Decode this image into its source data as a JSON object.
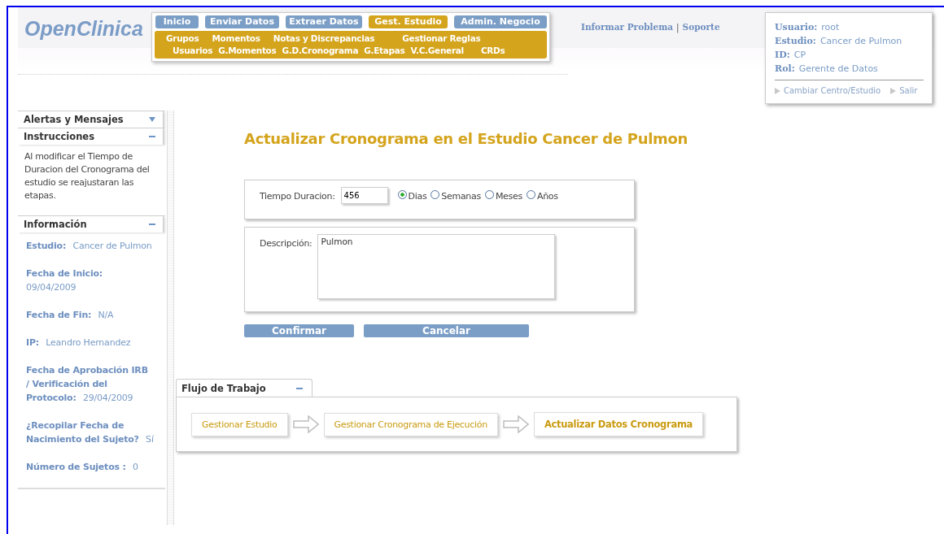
{
  "logo": "OpenClinica",
  "nav": {
    "main_tabs": [
      {
        "label": "Inicio",
        "selected": false
      },
      {
        "label": "Enviar Datos",
        "selected": false
      },
      {
        "label": "Extraer Datos",
        "selected": false
      },
      {
        "label": "Gest. Estudio",
        "selected": true
      },
      {
        "label": "Admin. Negocio",
        "selected": false
      }
    ],
    "sub_rows": [
      [
        "Grupos",
        "Momentos",
        "Notas y Discrepancias",
        "Gestionar Reglas"
      ],
      [
        "Usuarios",
        "G.Momentos",
        "G.D.Cronograma",
        "G.Etapas",
        "V.C.General",
        "CRDs"
      ]
    ]
  },
  "header_links": {
    "items": [
      "Informar Problema",
      "Soporte"
    ],
    "separator": "|"
  },
  "user_box": {
    "fields": [
      {
        "label": "Usuario:",
        "value": "root"
      },
      {
        "label": "Estudio:",
        "value": "Cancer de Pulmon"
      },
      {
        "label": "ID:",
        "value": "CP"
      },
      {
        "label": "Rol:",
        "value": "Gerente de Datos"
      }
    ],
    "links": [
      "Cambiar Centro/Estudio",
      "Salir"
    ]
  },
  "sidebar": {
    "panels": [
      {
        "title": "Alertas y Mensajes",
        "expanded": false
      },
      {
        "kind": "text",
        "title": "Instrucciones",
        "expanded": true,
        "text": "Al modificar el Tiempo de Duracion del Cronograma del estudio se reajustaran las etapas."
      },
      {
        "kind": "info",
        "title": "Información",
        "expanded": true,
        "items": [
          {
            "label": "Estudio:",
            "value": "Cancer de Pulmon"
          },
          {
            "label": "Fecha de Inicio:",
            "value": "09/04/2009"
          },
          {
            "label": "Fecha de Fin:",
            "value": "N/A"
          },
          {
            "label": "IP:",
            "value": "Leandro Hernandez"
          },
          {
            "label": "Fecha de Aprobación IRB / Verificación del Protocolo:",
            "value": "29/04/2009"
          },
          {
            "label": "¿Recopilar Fecha de Nacimiento del Sujeto?",
            "value": "Sí"
          },
          {
            "label": "Número de Sujetos :",
            "value": "0"
          }
        ]
      }
    ]
  },
  "page_title": "Actualizar Cronograma en el Estudio Cancer de Pulmon",
  "form": {
    "duration": {
      "label": "Tiempo Duracion:",
      "value": "456"
    },
    "units": [
      {
        "label": "Dias",
        "selected": true
      },
      {
        "label": "Semanas",
        "selected": false
      },
      {
        "label": "Meses",
        "selected": false
      },
      {
        "label": "Años",
        "selected": false
      }
    ],
    "description": {
      "label": "Descripción:",
      "value": "Pulmon"
    }
  },
  "buttons": [
    "Confirmar",
    "Cancelar"
  ],
  "workflow": {
    "title": "Flujo de Trabajo",
    "expanded": true,
    "steps": [
      {
        "label": "Gestionar Estudio",
        "current": false
      },
      {
        "label": "Gestionar Cronograma de Ejecución",
        "current": false
      },
      {
        "label": "Actualizar Datos Cronograma",
        "current": true
      }
    ]
  }
}
